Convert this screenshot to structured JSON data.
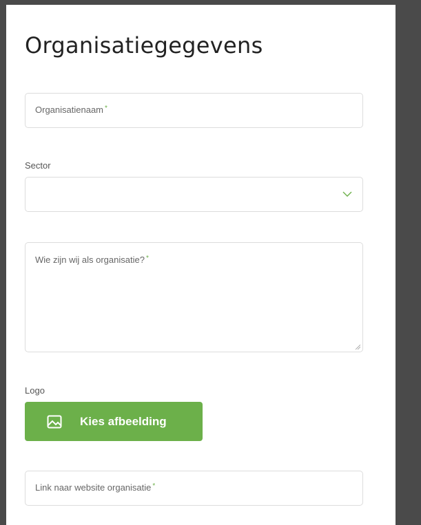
{
  "form": {
    "title": "Organisatiegegevens",
    "org_name": {
      "placeholder": "Organisatienaam",
      "required_mark": "*"
    },
    "sector": {
      "label": "Sector",
      "value": "",
      "icon": "chevron-down-icon"
    },
    "about": {
      "placeholder": "Wie zijn wij als organisatie?",
      "required_mark": "*"
    },
    "logo": {
      "label": "Logo",
      "button_label": "Kies afbeelding",
      "icon": "image-icon"
    },
    "website": {
      "placeholder": "Link naar website organisatie",
      "required_mark": "*"
    }
  },
  "colors": {
    "accent": "#6cb04a",
    "frame": "#4a4a4a",
    "border": "#dcdcdc"
  }
}
